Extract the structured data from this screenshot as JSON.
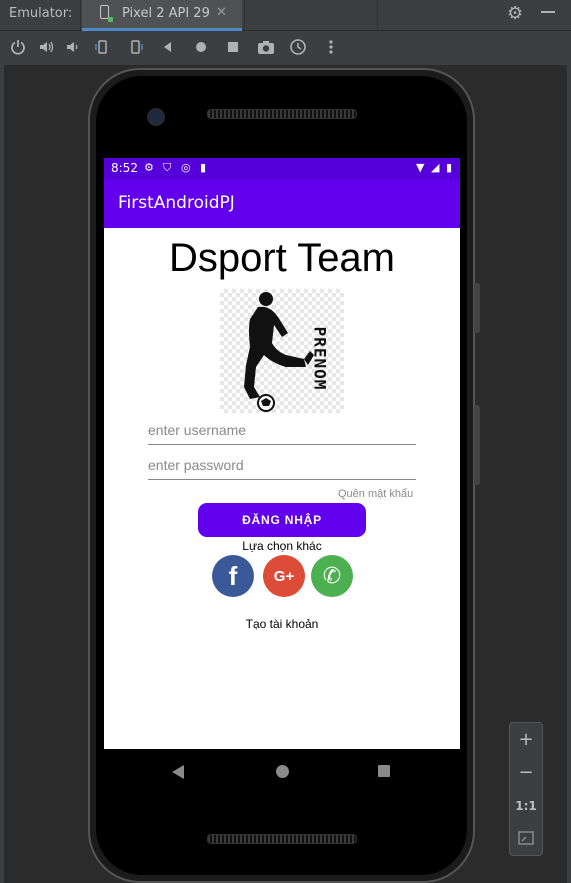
{
  "emulator": {
    "label": "Emulator:",
    "tab_label": "Pixel 2 API 29",
    "tab_close": "✕"
  },
  "toolbar": {
    "icons": [
      "power-icon",
      "volume-up-icon",
      "volume-down-icon",
      "rotate-left-icon",
      "rotate-right-icon",
      "back-icon",
      "home-icon",
      "overview-icon",
      "camera-icon",
      "snapshot-icon",
      "more-icon"
    ]
  },
  "status_bar": {
    "time": "8:52"
  },
  "app": {
    "title": "FirstAndroidPJ",
    "heading": "Dsport Team",
    "logo_text": "PRENOM",
    "username_placeholder": "enter username",
    "password_placeholder": "enter password",
    "forgot_password": "Quên mật khẩu",
    "login_button": "ĐĂNG NHẬP",
    "other_options": "Lựa chọn khác",
    "create_account": "Tạo tài khoản",
    "social": [
      {
        "name": "facebook",
        "glyph": "f",
        "color": "#3b5998"
      },
      {
        "name": "google-plus",
        "glyph": "G+",
        "color": "#dd4b39"
      },
      {
        "name": "whatsapp",
        "glyph": "✆",
        "color": "#4caf50"
      }
    ]
  },
  "zoom_panel": {
    "zoom_in": "+",
    "zoom_out": "−",
    "ratio": "1:1"
  },
  "colors": {
    "primary": "#6200ee",
    "status_bar": "#5600d9",
    "ide_background": "#3c3f41"
  }
}
